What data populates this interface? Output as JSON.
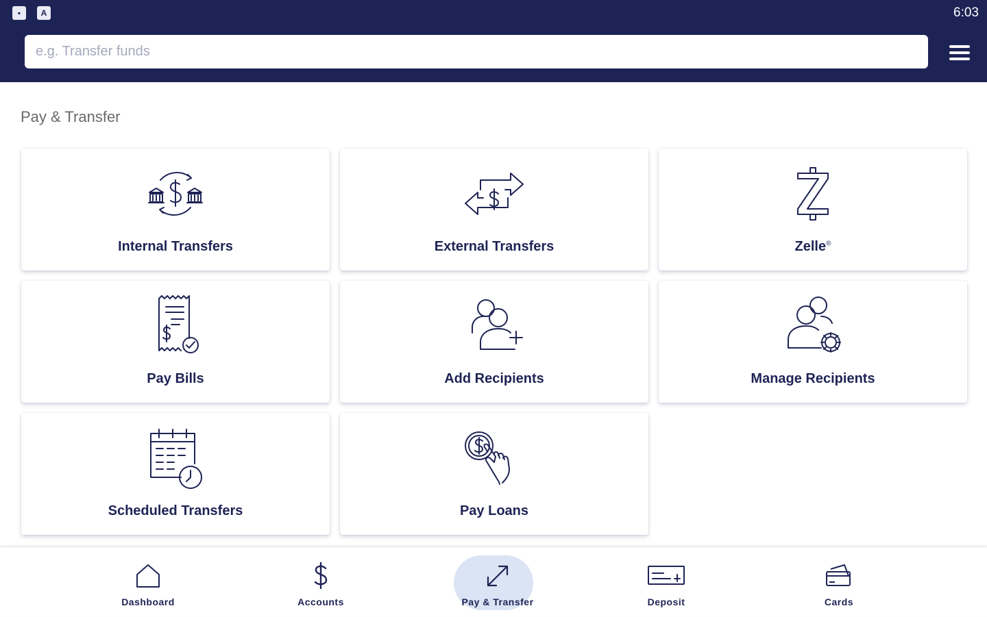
{
  "status_bar": {
    "left_icons": [
      "image-notification-icon",
      "app-notification-icon"
    ],
    "time": "6:03"
  },
  "header": {
    "search_placeholder": "e.g. Transfer funds",
    "menu_icon": "hamburger-menu-icon"
  },
  "page": {
    "title": "Pay & Transfer"
  },
  "tiles": [
    {
      "label": "Internal Transfers",
      "icon": "bank-transfer-icon"
    },
    {
      "label": "External Transfers",
      "icon": "dollar-exchange-arrows-icon"
    },
    {
      "label": "Zelle",
      "label_mark": "®",
      "icon": "zelle-icon"
    },
    {
      "label": "Pay Bills",
      "icon": "bill-receipt-icon"
    },
    {
      "label": "Add Recipients",
      "icon": "add-user-icon"
    },
    {
      "label": "Manage Recipients",
      "icon": "user-settings-icon"
    },
    {
      "label": "Scheduled Transfers",
      "icon": "calendar-clock-icon"
    },
    {
      "label": "Pay Loans",
      "icon": "hand-coin-icon"
    }
  ],
  "bottom_nav": [
    {
      "label": "Dashboard",
      "icon": "home-icon",
      "active": false
    },
    {
      "label": "Accounts",
      "icon": "dollar-icon",
      "active": false
    },
    {
      "label": "Pay & Transfer",
      "icon": "transfer-arrows-icon",
      "active": true
    },
    {
      "label": "Deposit",
      "icon": "check-deposit-icon",
      "active": false
    },
    {
      "label": "Cards",
      "icon": "cards-icon",
      "active": false
    }
  ],
  "colors": {
    "brand_navy": "#1e2355",
    "active_nav_bg": "#dbe4f4",
    "title_gray": "#6a6a6a",
    "placeholder_gray": "#a6a8bd"
  }
}
